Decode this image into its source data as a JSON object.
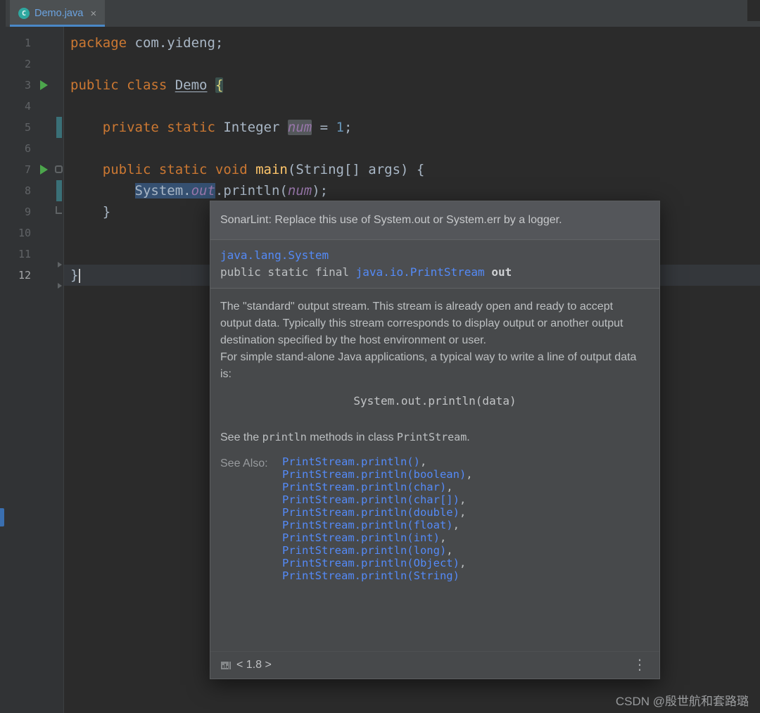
{
  "tab_bar": {
    "tab": {
      "label": "Demo.java",
      "icon_letter": "C",
      "close_glyph": "×"
    }
  },
  "editor": {
    "lines": [
      {
        "n": 1,
        "tokens": [
          {
            "c": "kw",
            "t": "package"
          },
          {
            "c": "pl",
            "t": " com.yideng;"
          }
        ]
      },
      {
        "n": 2,
        "tokens": []
      },
      {
        "n": 3,
        "run": true,
        "tokens": [
          {
            "c": "kw",
            "t": "public class "
          },
          {
            "c": "decl",
            "t": "Demo"
          },
          {
            "c": "pl",
            "t": " "
          },
          {
            "c": "brace",
            "t": "{"
          }
        ]
      },
      {
        "n": 4,
        "tokens": []
      },
      {
        "n": 5,
        "vcs": true,
        "tokens": [
          {
            "c": "pl",
            "t": "    "
          },
          {
            "c": "kw",
            "t": "private static "
          },
          {
            "c": "pl",
            "t": "Integer "
          },
          {
            "c": "fldhl",
            "t": "num"
          },
          {
            "c": "pl",
            "t": " = "
          },
          {
            "c": "num",
            "t": "1"
          },
          {
            "c": "pl",
            "t": ";"
          }
        ]
      },
      {
        "n": 6,
        "tokens": []
      },
      {
        "n": 7,
        "run": true,
        "fold": "box",
        "tokens": [
          {
            "c": "pl",
            "t": "    "
          },
          {
            "c": "kw",
            "t": "public static void "
          },
          {
            "c": "mth",
            "t": "main"
          },
          {
            "c": "pl",
            "t": "(String[] args) {"
          }
        ]
      },
      {
        "n": 8,
        "vcs": true,
        "tokens": [
          {
            "c": "pl",
            "t": "        "
          },
          {
            "c": "sel",
            "t": "System."
          },
          {
            "c": "selfld",
            "t": "out"
          },
          {
            "c": "pl",
            "t": ".println("
          },
          {
            "c": "fld",
            "t": "num"
          },
          {
            "c": "pl",
            "t": ");"
          }
        ]
      },
      {
        "n": 9,
        "fold": "end",
        "tokens": [
          {
            "c": "pl",
            "t": "    }"
          }
        ]
      },
      {
        "n": 10,
        "tokens": []
      },
      {
        "n": 11,
        "tokens": []
      },
      {
        "n": 12,
        "active": true,
        "fold": "arrows",
        "tokens": [
          {
            "c": "pl",
            "t": "}"
          },
          {
            "c": "caret",
            "t": ""
          }
        ]
      }
    ]
  },
  "popup": {
    "sonarlint": "SonarLint: Replace this use of System.out or System.err by a logger.",
    "definition": {
      "class_link": "java.lang.System",
      "modifiers": "public static final ",
      "type_link": "java.io.PrintStream",
      "member_name": " out"
    },
    "body": {
      "p1": "The \"standard\" output stream. This stream is already open and ready to accept output data. Typically this stream corresponds to display output or another output destination specified by the host environment or user.",
      "p2": "For simple stand-alone Java applications, a typical way to write a line of output data is:",
      "code_example": "System.out.println(data)",
      "p3_pre": "See the ",
      "p3_code1": "println",
      "p3_mid": " methods in class ",
      "p3_code2": "PrintStream",
      "p3_post": ".",
      "see_also_label": "See Also:",
      "see_also_links": [
        "PrintStream.println()",
        "PrintStream.println(boolean)",
        "PrintStream.println(char)",
        "PrintStream.println(char[])",
        "PrintStream.println(double)",
        "PrintStream.println(float)",
        "PrintStream.println(int)",
        "PrintStream.println(long)",
        "PrintStream.println(Object)",
        "PrintStream.println(String)"
      ]
    },
    "footer": {
      "version": "< 1.8 >",
      "menu_glyph": "⋮"
    }
  },
  "watermark": "CSDN @殷世航和套路璐",
  "colors": {
    "keyword": "#CC7832",
    "plain_text": "#A9B7C6",
    "field": "#9876AA",
    "number_literal": "#6897BB",
    "method_decl": "#FFC66B",
    "doc_link": "#548AF7",
    "run_arrow": "#4CA64C",
    "editor_bg": "#2B2B2B",
    "gutter_bg": "#313335",
    "popup_bg": "#47494B",
    "tab_underline": "#4A88C7"
  }
}
